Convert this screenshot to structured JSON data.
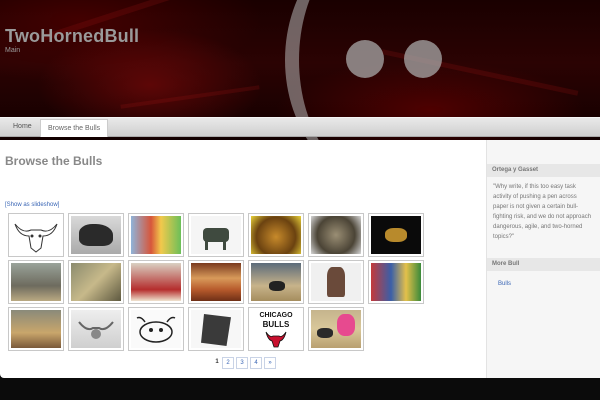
{
  "site": {
    "title": "TwoHornedBull",
    "tagline": "Main"
  },
  "nav": {
    "items": [
      "Home",
      "Browse the Bulls"
    ],
    "active": "Browse the Bulls"
  },
  "main": {
    "title": "Browse the Bulls",
    "slideshow_label": "[Show as slideshow]",
    "pagination": {
      "current": "1",
      "pages": [
        "2",
        "3",
        "4"
      ],
      "next": "»"
    },
    "thumbnails": [
      {
        "label": "bull-skull-sketch"
      },
      {
        "label": "bull-photo"
      },
      {
        "label": "painted-bull-statue"
      },
      {
        "label": "bull-figurine"
      },
      {
        "label": "golden-bull-head"
      },
      {
        "label": "bull-head-closeup"
      },
      {
        "label": "bull-artifact-dark"
      },
      {
        "label": "bullfight-arena"
      },
      {
        "label": "bull-mosaic"
      },
      {
        "label": "bullfight-red-cape"
      },
      {
        "label": "fresco-bull-leaping"
      },
      {
        "label": "bull-charging-crowd"
      },
      {
        "label": "bronze-bull-sculpture"
      },
      {
        "label": "bull-running-festival"
      },
      {
        "label": "bullfighter-action"
      },
      {
        "label": "bull-logo-silver"
      },
      {
        "label": "cartoon-bull-drawing"
      },
      {
        "label": "stone-bull-relief"
      },
      {
        "label": "chicago-bulls-logo"
      },
      {
        "label": "matador-pink-cape"
      }
    ]
  },
  "sidebar": {
    "quote_heading": "Ortega y Gasset",
    "quote_text": "\"Why write, if this too easy task activity of pushing a pen across paper is not given a certain bull-fighting risk, and we do not approach dangerous, agile, and two-horned topics?\"",
    "more_heading": "More Bull",
    "links": [
      "Bulls"
    ]
  },
  "logo_text": {
    "chicago": "CHICAGO",
    "bulls": "BULLS"
  },
  "colors": {
    "link": "#3a66b5",
    "banner": "#2b0303",
    "nav": "#dcdcdc"
  }
}
